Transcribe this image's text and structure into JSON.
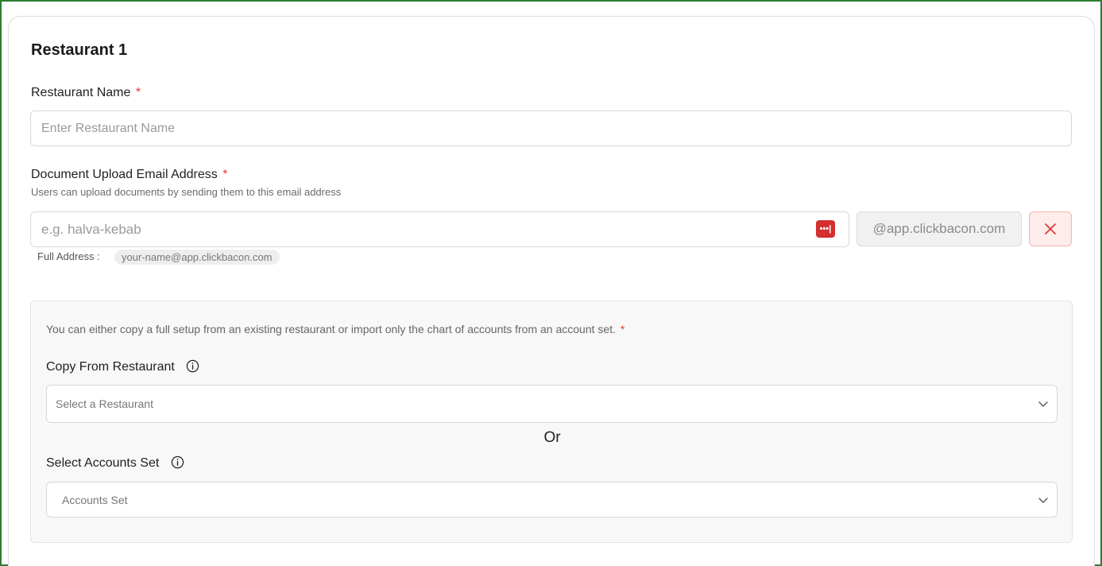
{
  "section": {
    "title": "Restaurant 1"
  },
  "restaurant_name": {
    "label": "Restaurant Name",
    "required_mark": "*",
    "placeholder": "Enter Restaurant Name",
    "value": ""
  },
  "email": {
    "label": "Document Upload Email Address",
    "required_mark": "*",
    "hint": "Users can upload documents by sending them to this email address",
    "placeholder": "e.g. halva-kebab",
    "value": "",
    "password_manager_icon": "password-manager-icon",
    "domain_suffix": "@app.clickbacon.com",
    "remove_icon": "close-icon",
    "full_address_label": "Full Address :",
    "full_address_value": "your-name@app.clickbacon.com"
  },
  "setup": {
    "note": "You can either copy a full setup from an existing restaurant or import only the chart of accounts from an account set.",
    "required_mark": "*",
    "copy_from": {
      "label": "Copy From Restaurant",
      "placeholder": "Select a Restaurant"
    },
    "or_text": "Or",
    "accounts_set": {
      "label": "Select Accounts Set",
      "placeholder": "Accounts Set"
    }
  },
  "colors": {
    "frame_border": "#2e7d32",
    "required": "#e53935",
    "pm_icon_bg": "#d32f2f",
    "remove_bg": "#fdecea",
    "remove_icon": "#e53935"
  }
}
